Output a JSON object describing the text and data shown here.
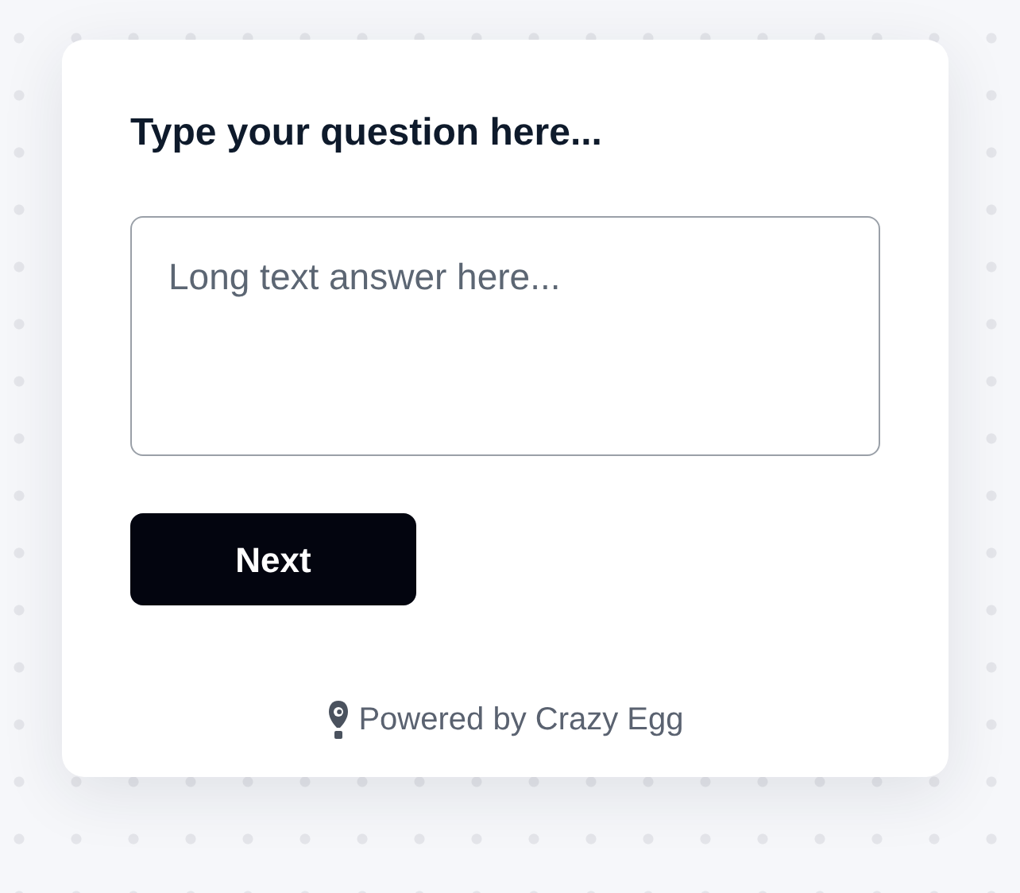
{
  "question": "Type your question here...",
  "answer": {
    "placeholder": "Long text answer here..."
  },
  "button": "Next",
  "footer": "Powered by Crazy Egg"
}
